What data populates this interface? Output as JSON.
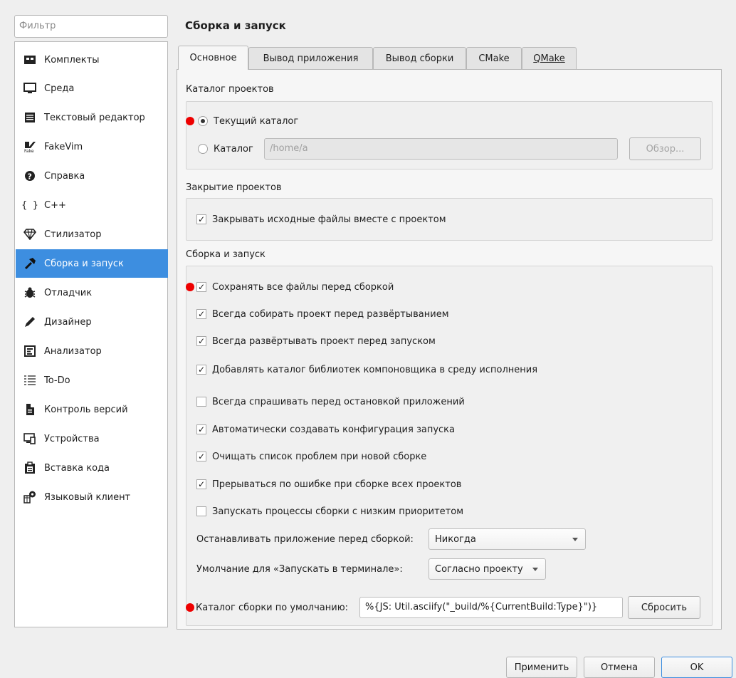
{
  "filter": {
    "placeholder": "Фильтр"
  },
  "categories": [
    {
      "label": "Комплекты",
      "icon": "kits-icon"
    },
    {
      "label": "Среда",
      "icon": "monitor-icon"
    },
    {
      "label": "Текстовый редактор",
      "icon": "text-editor-icon"
    },
    {
      "label": "FakeVim",
      "icon": "fakevim-icon"
    },
    {
      "label": "Справка",
      "icon": "help-icon"
    },
    {
      "label": "C++",
      "icon": "cpp-braces-icon"
    },
    {
      "label": "Стилизатор",
      "icon": "beautifier-icon"
    },
    {
      "label": "Сборка и запуск",
      "icon": "hammer-icon",
      "active": true
    },
    {
      "label": "Отладчик",
      "icon": "bug-icon"
    },
    {
      "label": "Дизайнер",
      "icon": "pen-icon"
    },
    {
      "label": "Анализатор",
      "icon": "analyzer-icon"
    },
    {
      "label": "To-Do",
      "icon": "todo-list-icon"
    },
    {
      "label": "Контроль версий",
      "icon": "version-control-icon"
    },
    {
      "label": "Устройства",
      "icon": "devices-icon"
    },
    {
      "label": "Вставка кода",
      "icon": "code-paste-icon"
    },
    {
      "label": "Языковый клиент",
      "icon": "language-client-icon"
    }
  ],
  "page_title": "Сборка и запуск",
  "tabs": [
    {
      "label": "Основное",
      "active": true
    },
    {
      "label": "Вывод приложения"
    },
    {
      "label": "Вывод сборки"
    },
    {
      "label": "CMake"
    },
    {
      "label": "QMake"
    }
  ],
  "projects_dir": {
    "title": "Каталог проектов",
    "current_label": "Текущий каталог",
    "dir_label": "Каталог",
    "path": "/home/a",
    "browse": "Обзор..."
  },
  "closing": {
    "title": "Закрытие проектов",
    "close_files": "Закрывать исходные файлы вместе с проектом"
  },
  "build_run": {
    "title": "Сборка и запуск",
    "options": [
      {
        "label": "Сохранять все файлы перед сборкой",
        "checked": true
      },
      {
        "label": "Всегда собирать проект перед развёртыванием",
        "checked": true
      },
      {
        "label": "Всегда развёртывать проект перед запуском",
        "checked": true
      },
      {
        "label": "Добавлять каталог библиотек компоновщика в среду исполнения",
        "checked": true
      },
      {
        "label": "Всегда спрашивать перед остановкой приложений",
        "checked": false
      },
      {
        "label": "Автоматически создавать конфигурация запуска",
        "checked": true
      },
      {
        "label": "Очищать список проблем при новой сборке",
        "checked": true
      },
      {
        "label": "Прерываться по ошибке при сборке всех проектов",
        "checked": true
      },
      {
        "label": "Запускать процессы сборки с низким приоритетом",
        "checked": false
      }
    ],
    "stop_label": "Останавливать приложение перед сборкой:",
    "stop_value": "Никогда",
    "terminal_label": "Умолчание для «Запускать в терминале»:",
    "terminal_value": "Согласно проекту",
    "build_dir_label": "Каталог сборки по умолчанию:",
    "build_dir_value": "%{JS: Util.asciify(\"_build/%{CurrentBuild:Type}\")}",
    "reset": "Сбросить"
  },
  "footer": {
    "apply": "Применить",
    "cancel": "Отмена",
    "ok": "OK"
  }
}
